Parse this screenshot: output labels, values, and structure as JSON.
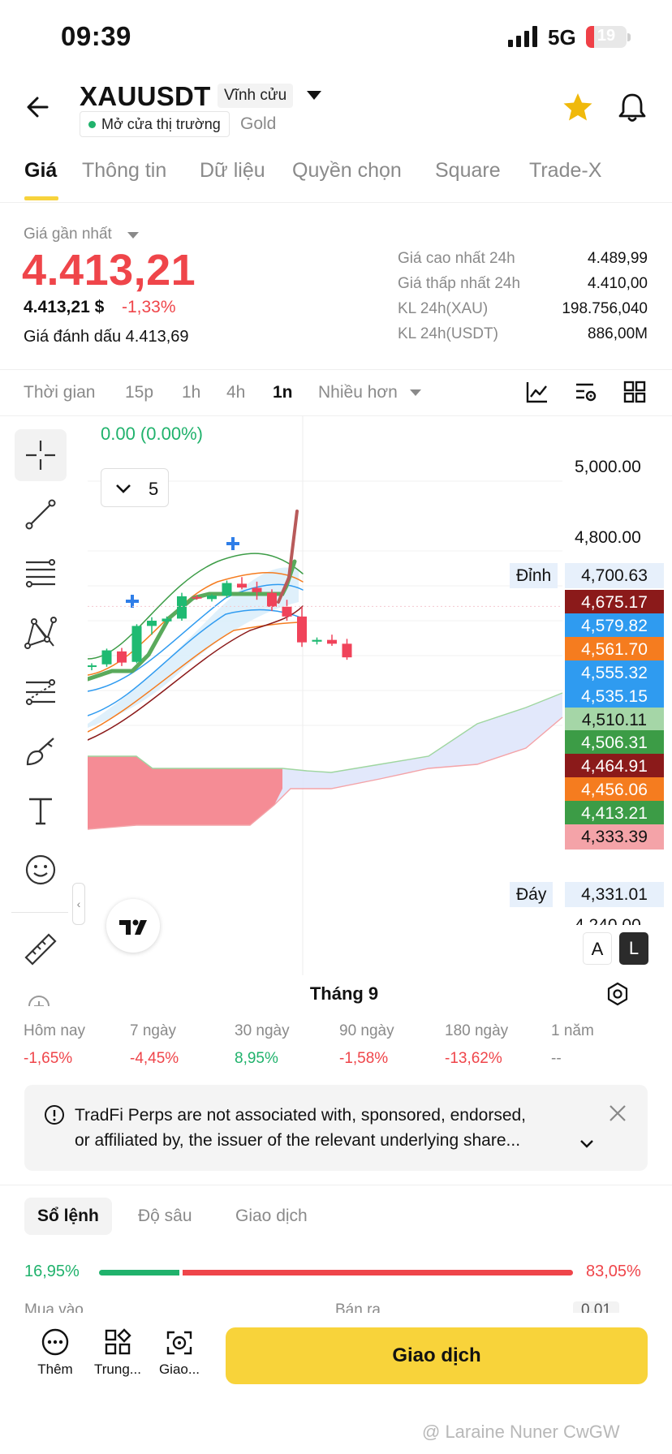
{
  "status_bar": {
    "time": "09:39",
    "network": "5G",
    "battery": "19",
    "battery_level": 0.19
  },
  "header": {
    "symbol": "XAUUSDT",
    "contract_type": "Vĩnh cửu",
    "market_status": "Mở cửa thị trường",
    "underlying": "Gold",
    "icons": [
      "back-arrow-icon",
      "star-icon",
      "bell-icon"
    ],
    "star_color": "#f0b90b"
  },
  "tabs": [
    "Giá",
    "Thông tin",
    "Dữ liệu",
    "Quyền chọn",
    "Square",
    "Trade-X"
  ],
  "price": {
    "last_label": "Giá gần nhất",
    "last_price": "4.413,21",
    "usd_price": "4.413,21 $",
    "change_pct": "-1,33%",
    "mark_label": "Giá đánh dấu",
    "mark_price": "4.413,69",
    "down_color": "#ef454a",
    "up_color": "#20b26c",
    "stats": [
      {
        "label": "Giá cao nhất 24h",
        "value": "4.489,99"
      },
      {
        "label": "Giá thấp nhất 24h",
        "value": "4.410,00"
      },
      {
        "label": "KL 24h(XAU)",
        "value": "198.756,040"
      },
      {
        "label": "KL 24h(USDT)",
        "value": "886,00M"
      }
    ]
  },
  "timeframes": {
    "items": [
      "Thời gian",
      "15p",
      "1h",
      "4h",
      "1n",
      "Nhiều hơn"
    ],
    "active": "1n",
    "tool_icons": [
      "indicator-icon",
      "chart-settings-icon",
      "grid-layout-icon"
    ]
  },
  "drawing_tools": [
    "crosshair-icon",
    "trend-line-icon",
    "horizontal-lines-icon",
    "pattern-icon",
    "fibonacci-icon",
    "brush-icon",
    "text-icon",
    "emoji-icon",
    "ruler-icon"
  ],
  "chart": {
    "change_readout": "0.00 (0.00%)",
    "ma_count": "5",
    "axis_ticks": [
      "5,000.00",
      "4,800.00"
    ],
    "top_label": "Đỉnh",
    "top_value": "4,700.63",
    "bottom_label": "Đáy",
    "bottom_value": "4,331.01",
    "scale_buttons": [
      "A",
      "L"
    ],
    "month": "Tháng 9",
    "price_tags": [
      {
        "value": "4,675.17",
        "color": "#8b1a1a"
      },
      {
        "value": "4,579.82",
        "color": "#2f9bf0"
      },
      {
        "value": "4,561.70",
        "color": "#f57c1f"
      },
      {
        "value": "4,555.32",
        "color": "#2f9bf0"
      },
      {
        "value": "4,535.15",
        "color": "#2f9bf0"
      },
      {
        "value": "4,510.11",
        "color": "#a5d6a7",
        "text_color": "#121212"
      },
      {
        "value": "4,506.31",
        "color": "#3c9c46"
      },
      {
        "value": "4,464.91",
        "color": "#8b1a1a"
      },
      {
        "value": "4,456.06",
        "color": "#f57c1f"
      },
      {
        "value": "4,413.21",
        "color": "#3c9c46"
      },
      {
        "value": "4,333.39",
        "color": "#f4a3a8",
        "text_color": "#121212"
      }
    ]
  },
  "chart_data": {
    "type": "candlestick",
    "title": "",
    "y_axis_ticks": [
      5000.0,
      4800.0
    ],
    "y_range_visible_labels": [
      "5,000.00",
      "4,800.00",
      "4,700.63",
      "4,331.01"
    ],
    "x_label": "Tháng 9",
    "last_close": 4413.21,
    "period_high": 4700.63,
    "period_low": 4331.01,
    "moving_averages": [
      4675.17,
      4579.82,
      4561.7,
      4555.32,
      4535.15,
      4510.11,
      4506.31,
      4464.91,
      4456.06,
      4413.21,
      4333.39
    ],
    "candles_ohlc": [
      [
        4468,
        4478,
        4458,
        4472
      ],
      [
        4475,
        4520,
        4468,
        4515
      ],
      [
        4512,
        4522,
        4470,
        4480
      ],
      [
        4482,
        4590,
        4478,
        4585
      ],
      [
        4585,
        4610,
        4560,
        4600
      ],
      [
        4598,
        4612,
        4590,
        4606
      ],
      [
        4606,
        4680,
        4600,
        4670
      ],
      [
        4668,
        4674,
        4660,
        4664
      ],
      [
        4662,
        4676,
        4655,
        4672
      ],
      [
        4672,
        4715,
        4665,
        4708
      ],
      [
        4706,
        4725,
        4690,
        4695
      ],
      [
        4694,
        4712,
        4660,
        4682
      ],
      [
        4680,
        4690,
        4628,
        4640
      ],
      [
        4640,
        4660,
        4600,
        4612
      ],
      [
        4612,
        4640,
        4525,
        4538
      ],
      [
        4540,
        4552,
        4532,
        4545
      ],
      [
        4545,
        4560,
        4528,
        4534
      ],
      [
        4534,
        4548,
        4488,
        4495
      ]
    ]
  },
  "performance": [
    {
      "label": "Hôm nay",
      "value": "-1,65%",
      "trend": "down"
    },
    {
      "label": "7 ngày",
      "value": "-4,45%",
      "trend": "down"
    },
    {
      "label": "30 ngày",
      "value": "8,95%",
      "trend": "up"
    },
    {
      "label": "90 ngày",
      "value": "-1,58%",
      "trend": "down"
    },
    {
      "label": "180 ngày",
      "value": "-13,62%",
      "trend": "down"
    },
    {
      "label": "1 năm",
      "value": "--",
      "trend": "none"
    }
  ],
  "notice": {
    "line1": "TradFi Perps are not associated with, sponsored, endorsed,",
    "line2": "or affiliated by, the issuer of the relevant underlying share..."
  },
  "orderbook": {
    "tabs": [
      "Sổ lệnh",
      "Độ sâu",
      "Giao dịch"
    ],
    "buy_pct": "16,95%",
    "sell_pct": "83,05%",
    "buy_ratio": 0.1695,
    "buy_label": "Mua vào",
    "sell_label": "Bán ra",
    "precision": "0,01"
  },
  "bottom_bar": {
    "buttons": [
      {
        "label": "Thêm",
        "icon": "more-dots-icon"
      },
      {
        "label": "Trung...",
        "icon": "apps-icon"
      },
      {
        "label": "Giao...",
        "icon": "copy-trade-icon"
      }
    ],
    "trade_label": "Giao dịch",
    "trade_color": "#f8d33a"
  },
  "watermark": "@ Laraine Nuner CwGW"
}
